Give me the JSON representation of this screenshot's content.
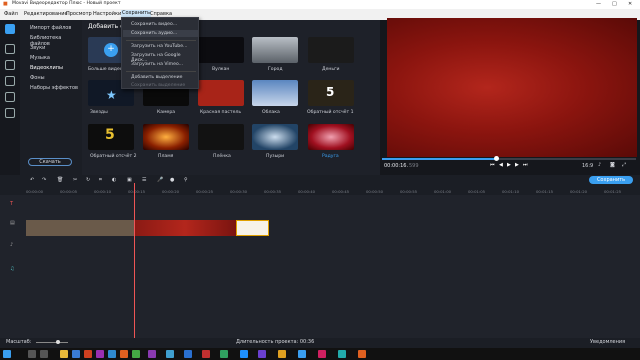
{
  "window": {
    "title": "Movavi Видеоредактор Плюс - Новый проект"
  },
  "menu": [
    "Файл",
    "Редактирование",
    "Просмотр",
    "Настройки",
    "Сохранить",
    "Справка"
  ],
  "sidebar": {
    "items": [
      "Импорт файлов",
      "Библиотека файлов",
      "Звуки",
      "Музыка",
      "Видеоклипы",
      "Фоны",
      "Наборы эффектов"
    ],
    "download_label": "Скачать"
  },
  "gallery": {
    "title": "Добавить с",
    "items": [
      "Больше видео",
      "",
      "Вулкан",
      "Город",
      "Деньги",
      "Звезды",
      "Камера",
      "Красная пастель",
      "Облака",
      "Обратный отсчёт 1",
      "Обратный отсчёт 2",
      "Пламя",
      "Плёнка",
      "Пузыри",
      "Радуга"
    ]
  },
  "dropdown": {
    "items": [
      "Сохранить видео...",
      "Сохранить аудио...",
      "Загрузить на YouTube...",
      "Загрузить на Google Диск...",
      "Загрузить на Vimeo...",
      "Добавить выделение",
      "Сохранить выделение"
    ]
  },
  "preview": {
    "time": "00:00:16.",
    "time_ms": "599",
    "ratio": "16:9"
  },
  "timeline": {
    "save_label": "Сохранить",
    "ticks": [
      "00:00:00",
      "00:00:05",
      "00:00:10",
      "00:00:15",
      "00:00:20",
      "00:00:25",
      "00:00:30",
      "00:00:35",
      "00:00:40",
      "00:00:45",
      "00:00:50",
      "00:00:55",
      "00:01:00",
      "00:01:05",
      "00:01:10",
      "00:01:15",
      "00:01:20",
      "00:01:25",
      "00:01:30"
    ]
  },
  "status": {
    "zoom_label": "Масштаб:",
    "duration": "Длительность проекта: 00:36",
    "notifications": "Уведомления"
  },
  "colors": {
    "accent": "#3a9ff0",
    "highlight": "#cce4f7"
  }
}
